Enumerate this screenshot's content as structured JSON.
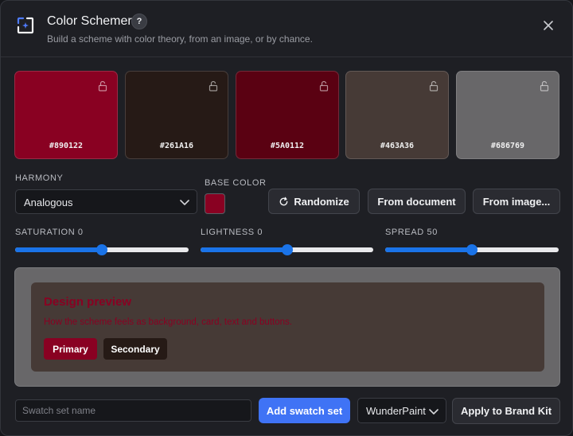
{
  "header": {
    "title": "Color Schemer",
    "help_label": "?",
    "subtitle": "Build a scheme with color theory, from an image, or by chance.",
    "app_icon": "color-schemer-icon",
    "close_icon": "close-icon"
  },
  "swatches": [
    {
      "hex": "#890122",
      "color": "#890122",
      "lock_icon": "lock-open-icon"
    },
    {
      "hex": "#261A16",
      "color": "#261A16",
      "lock_icon": "lock-open-icon"
    },
    {
      "hex": "#5A0112",
      "color": "#5A0112",
      "lock_icon": "lock-open-icon"
    },
    {
      "hex": "#463A36",
      "color": "#463A36",
      "lock_icon": "lock-open-icon"
    },
    {
      "hex": "#686769",
      "color": "#686769",
      "lock_icon": "lock-open-icon"
    }
  ],
  "controls": {
    "harmony_label": "HARMONY",
    "harmony_value": "Analogous",
    "base_color_label": "BASE COLOR",
    "base_color": "#890122",
    "randomize_label": "Randomize",
    "from_document_label": "From document",
    "from_image_label": "From image..."
  },
  "sliders": [
    {
      "label": "SATURATION 0",
      "fraction": 0.5
    },
    {
      "label": "LIGHTNESS 0",
      "fraction": 0.5
    },
    {
      "label": "SPREAD 50",
      "fraction": 0.5
    }
  ],
  "preview": {
    "title": "Design preview",
    "text": "How the scheme feels as background, card, text and buttons.",
    "primary_label": "Primary",
    "secondary_label": "Secondary",
    "background_color": "#686769",
    "card_color": "#463A36",
    "accent_color": "#890122",
    "secondary_color": "#261A16"
  },
  "footer": {
    "name_placeholder": "Swatch set name",
    "name_value": "",
    "add_label": "Add swatch set",
    "kit_value": "WunderPaint",
    "apply_label": "Apply to Brand Kit"
  }
}
